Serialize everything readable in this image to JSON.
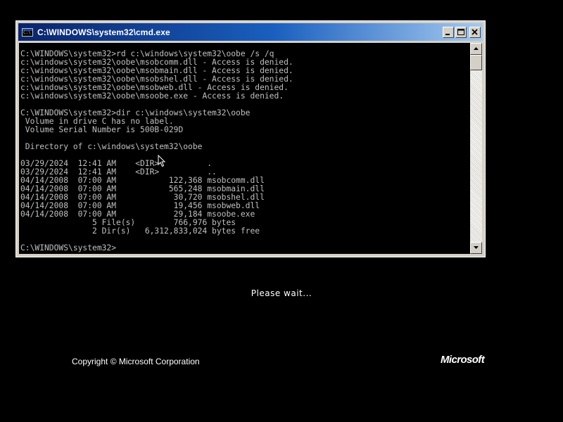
{
  "cmd_window": {
    "title": "C:\\WINDOWS\\system32\\cmd.exe",
    "console_lines": [
      "C:\\WINDOWS\\system32>rd c:\\windows\\system32\\oobe /s /q",
      "c:\\windows\\system32\\oobe\\msobcomm.dll - Access is denied.",
      "c:\\windows\\system32\\oobe\\msobmain.dll - Access is denied.",
      "c:\\windows\\system32\\oobe\\msobshel.dll - Access is denied.",
      "c:\\windows\\system32\\oobe\\msobweb.dll - Access is denied.",
      "c:\\windows\\system32\\oobe\\msoobe.exe - Access is denied.",
      "",
      "C:\\WINDOWS\\system32>dir c:\\windows\\system32\\oobe",
      " Volume in drive C has no label.",
      " Volume Serial Number is 500B-029D",
      "",
      " Directory of c:\\windows\\system32\\oobe",
      "",
      "03/29/2024  12:41 AM    <DIR>          .",
      "03/29/2024  12:41 AM    <DIR>          ..",
      "04/14/2008  07:00 AM           122,368 msobcomm.dll",
      "04/14/2008  07:00 AM           565,248 msobmain.dll",
      "04/14/2008  07:00 AM            30,720 msobshel.dll",
      "04/14/2008  07:00 AM            19,456 msobweb.dll",
      "04/14/2008  07:00 AM            29,184 msoobe.exe",
      "               5 File(s)        766,976 bytes",
      "               2 Dir(s)   6,312,833,024 bytes free",
      "",
      "C:\\WINDOWS\\system32>"
    ]
  },
  "setup_screen": {
    "status_text": "Please wait...",
    "copyright": "Copyright © Microsoft Corporation",
    "logo_text": "Microsoft"
  },
  "colors": {
    "console_background": "#000000",
    "console_text": "#c0c0c0",
    "titlebar_start": "#0a246a",
    "titlebar_end": "#a6caf0",
    "window_chrome": "#d4d0c8"
  },
  "icons": [
    "cmd-icon",
    "minimize-icon",
    "maximize-icon",
    "close-icon",
    "scroll-up-arrow-icon",
    "scroll-down-arrow-icon",
    "mouse-pointer-icon"
  ]
}
